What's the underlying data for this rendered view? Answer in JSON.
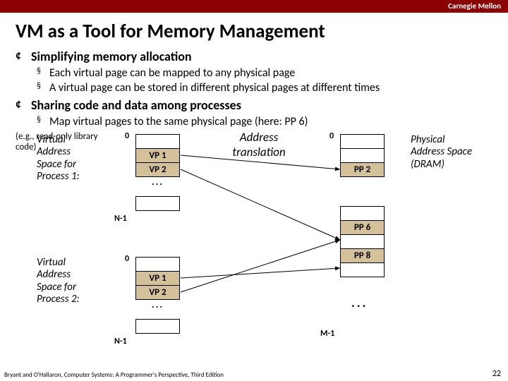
{
  "header": {
    "org": "Carnegie Mellon"
  },
  "title": "VM as a Tool for Memory Management",
  "bullets": {
    "b1": "Simplifying memory allocation",
    "b1a": "Each virtual page can be mapped to any physical page",
    "b1b": "A virtual page can be stored in different physical pages at different times",
    "b2": "Sharing code and data among processes",
    "b2a": "Map virtual pages to the same physical page (here: PP 6)"
  },
  "diagram": {
    "vas1_label": "Virtual Address Space for Process 1:",
    "vas2_label": "Virtual Address Space for Process 2:",
    "pas_label": "Physical Address Space (DRAM)",
    "addr_trans": "Address translation",
    "eg": "(e.g., read-only library code)",
    "vp1": "VP 1",
    "vp2": "VP 2",
    "pp2": "PP 2",
    "pp6": "PP 6",
    "pp8": "PP 8",
    "zero": "0",
    "nminus1": "N-1",
    "mminus1": "M-1",
    "dots": "..."
  },
  "footer": "Bryant and O'Hallaron, Computer Systems: A Programmer's Perspective, Third Edition",
  "page": "22"
}
